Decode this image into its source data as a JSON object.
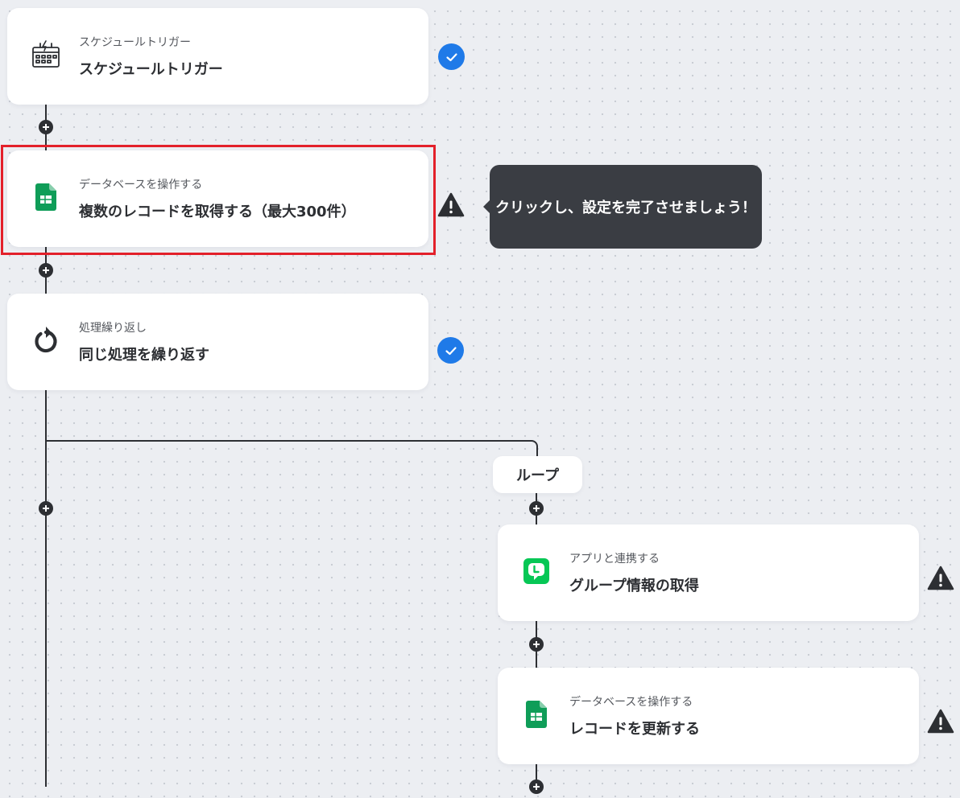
{
  "flow": {
    "steps": [
      {
        "subtitle": "スケジュールトリガー",
        "title": "スケジュールトリガー",
        "icon": "calendar-schedule-icon",
        "status": "complete"
      },
      {
        "subtitle": "データベースを操作する",
        "title": "複数のレコードを取得する（最大300件）",
        "icon": "google-sheets-icon",
        "status": "warning"
      },
      {
        "subtitle": "処理繰り返し",
        "title": "同じ処理を繰り返す",
        "icon": "loop-arrow-icon",
        "status": "complete"
      }
    ],
    "loop": {
      "label": "ループ",
      "steps": [
        {
          "subtitle": "アプリと連携する",
          "title": "グループ情報の取得",
          "icon": "line-app-icon",
          "status": "warning"
        },
        {
          "subtitle": "データベースを操作する",
          "title": "レコードを更新する",
          "icon": "google-sheets-icon",
          "status": "warning"
        }
      ]
    },
    "tooltip": "クリックし、設定を完了させましょう！"
  },
  "colors": {
    "background": "#eceef2",
    "connector": "#2d2f33",
    "check": "#1f7ae8",
    "highlight": "#e3202a",
    "tooltip_bg": "#3a3d43",
    "sheets_green": "#0f9d58",
    "line_green": "#06c755"
  }
}
